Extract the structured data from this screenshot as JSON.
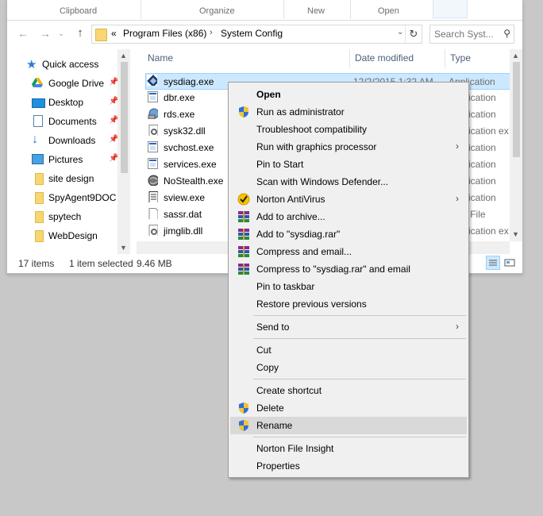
{
  "ribbon": {
    "groups": [
      "Clipboard",
      "Organize",
      "New",
      "Open"
    ]
  },
  "address": {
    "overflow": "«",
    "crumbs": [
      "Program Files (x86)",
      "System Config"
    ],
    "search_placeholder": "Search Syst..."
  },
  "nav": {
    "items": [
      {
        "label": "Quick access",
        "icon": "star-icon",
        "pinned": false
      },
      {
        "label": "Google Drive",
        "icon": "google-drive-icon",
        "pinned": true
      },
      {
        "label": "Desktop",
        "icon": "desktop-icon",
        "pinned": true
      },
      {
        "label": "Documents",
        "icon": "documents-icon",
        "pinned": true
      },
      {
        "label": "Downloads",
        "icon": "downloads-icon",
        "pinned": true
      },
      {
        "label": "Pictures",
        "icon": "pictures-icon",
        "pinned": true
      },
      {
        "label": "site design",
        "icon": "folder-icon",
        "pinned": false
      },
      {
        "label": "SpyAgent9DOC",
        "icon": "folder-icon",
        "pinned": false
      },
      {
        "label": "spytech",
        "icon": "folder-icon",
        "pinned": false
      },
      {
        "label": "WebDesign",
        "icon": "folder-icon",
        "pinned": false
      }
    ]
  },
  "columns": {
    "name": "Name",
    "date": "Date modified",
    "type": "Type"
  },
  "files": [
    {
      "name": "sysdiag.exe",
      "date": "12/2/2015 1:32 AM",
      "type": "Application",
      "selected": true
    },
    {
      "name": "dbr.exe",
      "date": "",
      "type": "Application",
      "selected": false
    },
    {
      "name": "rds.exe",
      "date": "",
      "type": "Application",
      "selected": false
    },
    {
      "name": "sysk32.dll",
      "date": "",
      "type": "Application ex",
      "selected": false
    },
    {
      "name": "svchost.exe",
      "date": "",
      "type": "Application",
      "selected": false
    },
    {
      "name": "services.exe",
      "date": "",
      "type": "Application",
      "selected": false
    },
    {
      "name": "NoStealth.exe",
      "date": "",
      "type": "Application",
      "selected": false
    },
    {
      "name": "sview.exe",
      "date": "",
      "type": "Application",
      "selected": false
    },
    {
      "name": "sassr.dat",
      "date": "",
      "type": "DAT File",
      "selected": false
    },
    {
      "name": "jimglib.dll",
      "date": "",
      "type": "Application ex",
      "selected": false
    }
  ],
  "status": {
    "count": "17 items",
    "selection": "1 item selected",
    "size": "9.46 MB"
  },
  "context_menu": [
    {
      "label": "Open",
      "bold": true
    },
    {
      "label": "Run as administrator",
      "icon": "uac-shield-icon"
    },
    {
      "label": "Troubleshoot compatibility"
    },
    {
      "label": "Run with graphics processor",
      "submenu": true
    },
    {
      "label": "Pin to Start"
    },
    {
      "label": "Scan with Windows Defender..."
    },
    {
      "label": "Norton AntiVirus",
      "icon": "norton-icon",
      "submenu": true
    },
    {
      "label": "Add to archive...",
      "icon": "winrar-icon"
    },
    {
      "label": "Add to \"sysdiag.rar\"",
      "icon": "winrar-icon"
    },
    {
      "label": "Compress and email...",
      "icon": "winrar-icon"
    },
    {
      "label": "Compress to \"sysdiag.rar\" and email",
      "icon": "winrar-icon"
    },
    {
      "label": "Pin to taskbar"
    },
    {
      "label": "Restore previous versions"
    },
    {
      "label": "Send to",
      "submenu": true
    },
    {
      "label": "Cut"
    },
    {
      "label": "Copy"
    },
    {
      "label": "Create shortcut"
    },
    {
      "label": "Delete",
      "icon": "uac-shield-icon"
    },
    {
      "label": "Rename",
      "icon": "uac-shield-icon",
      "highlighted": true
    },
    {
      "label": "Norton File Insight"
    },
    {
      "label": "Properties"
    }
  ]
}
